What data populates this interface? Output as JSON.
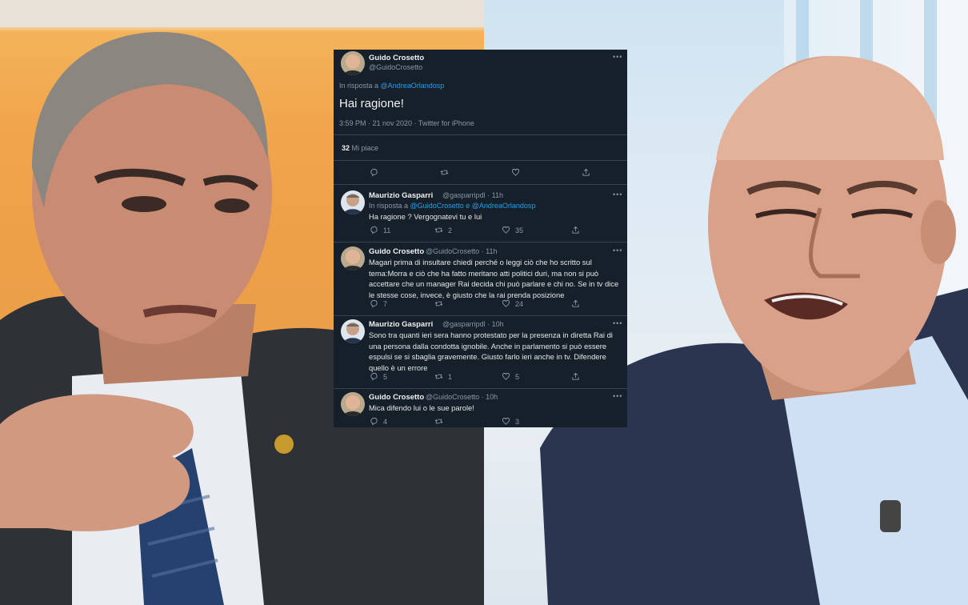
{
  "main_tweet": {
    "name": "Guido Crosetto",
    "handle": "@GuidoCrosetto",
    "reply_prefix": "In risposta a",
    "reply_to": "@AndreaOrlandosp",
    "text": "Hai ragione!",
    "timestamp": "3:59 PM · 21 nov 2020 · Twitter for iPhone",
    "likes_count": "32",
    "likes_label": "Mi piace"
  },
  "replies": [
    {
      "name": "Maurizio Gasparri",
      "handle": "@gasparripdl · 11h",
      "reply_prefix": "In risposta a",
      "reply_to": "@GuidoCrosetto e @AndreaOrlandosp",
      "text": "Ha ragione ? Vergognatevi  tu e lui",
      "reply_count": "11",
      "retweet_count": "2",
      "like_count": "35"
    },
    {
      "name": "Guido Crosetto",
      "handle": "@GuidoCrosetto · 11h",
      "text": "Magari prima di insultare chiedi perché o leggi ciò che ho scritto sul tema:Morra e ciò che ha fatto meritano atti politici duri, ma non si può accettare che un manager Rai decida chi può parlare e chi no. Se in tv dice le stesse cose, invece, è giusto che la rai prenda posizione",
      "reply_count": "7",
      "retweet_count": "",
      "like_count": "24"
    },
    {
      "name": "Maurizio Gasparri",
      "handle": "@gasparripdl · 10h",
      "text": "Sono tra quanti ieri sera hanno protestato per la presenza in diretta Rai di una persona dalla condotta ignobile. Anche in parlamento si può essere espulsi se si sbaglia gravemente. Giusto farlo ieri anche in tv. Difendere quello è un errore",
      "reply_count": "5",
      "retweet_count": "1",
      "like_count": "5"
    },
    {
      "name": "Guido Crosetto",
      "handle": "@GuidoCrosetto · 10h",
      "text": "Mica difendo lui o le sue parole!",
      "reply_count": "4",
      "retweet_count": "",
      "like_count": "3"
    }
  ],
  "ui": {
    "more": "•••"
  },
  "colors": {
    "card_bg": "#15202b",
    "link": "#1da1f2",
    "muted": "#8899a6"
  }
}
